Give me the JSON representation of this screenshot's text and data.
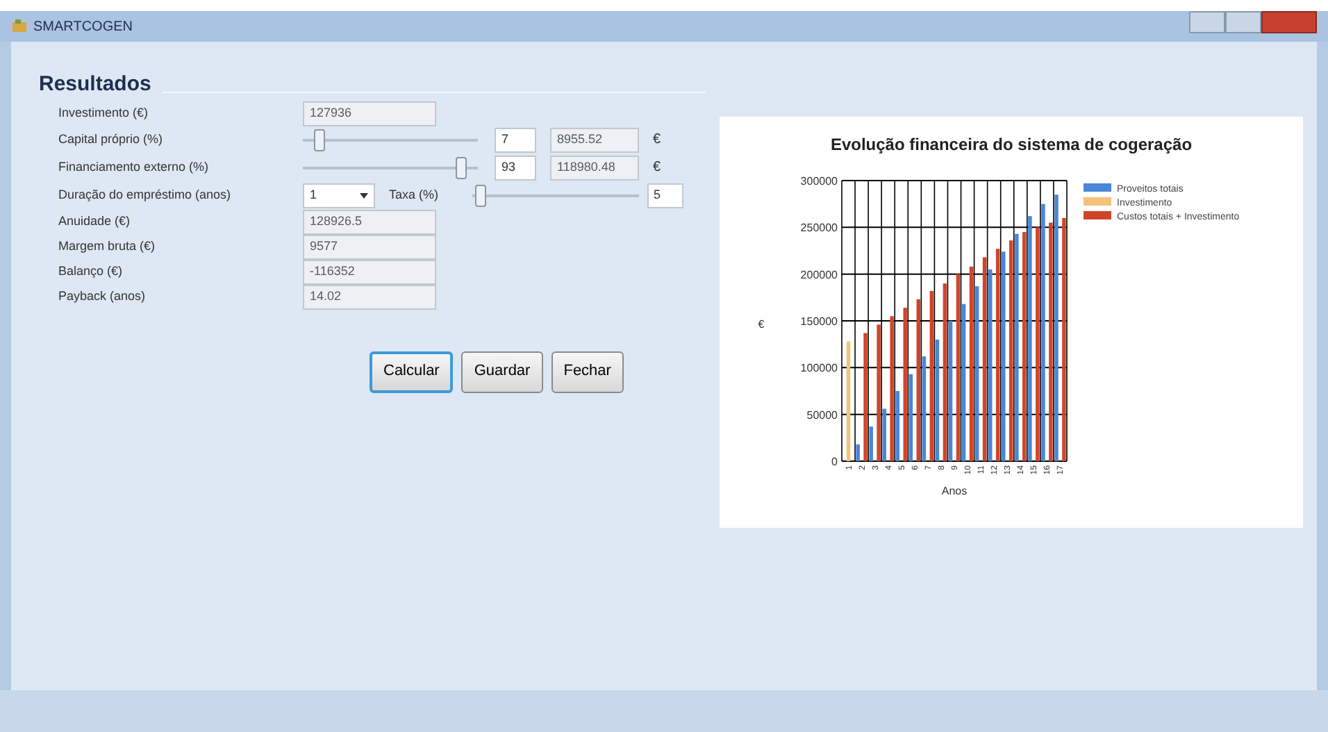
{
  "window": {
    "title": "SMARTCOGEN"
  },
  "section_title": "Resultados",
  "investimento": {
    "label": "Investimento (€)",
    "value": "127936"
  },
  "capital": {
    "label": "Capital próprio (%)",
    "level": 0.07,
    "percent": "7",
    "amount": "8955.52",
    "unit": "€"
  },
  "financiamento": {
    "label": "Financiamento externo (%)",
    "percent": "93",
    "amount": "118980.48",
    "unit": "€"
  },
  "duracao": {
    "label": "Duração do empréstimo (anos)",
    "value": "1",
    "rate_label": "Taxa (%)",
    "rate": "5"
  },
  "results": [
    {
      "label": "Anuidade (€)",
      "value": "128926.5"
    },
    {
      "label": "Margem bruta (€)",
      "value": "9577"
    },
    {
      "label": "Balanço (€)",
      "value": "-116352"
    },
    {
      "label": "Payback (anos)",
      "value": "14.02"
    }
  ],
  "buttons": [
    {
      "label": "Calcular",
      "selected": true
    },
    {
      "label": "Guardar",
      "selected": false
    },
    {
      "label": "Fechar",
      "selected": false
    }
  ],
  "chart_data": {
    "type": "bar",
    "title": "Evolução financeira do sistema de cogeração",
    "xlabel": "Anos",
    "ylabel": "€",
    "categories": [
      "1",
      "2",
      "3",
      "4",
      "5",
      "6",
      "7",
      "8",
      "9",
      "10",
      "11",
      "12",
      "13",
      "14",
      "15",
      "16",
      "17"
    ],
    "series": [
      {
        "name": "Proveitos totais",
        "color": "#4a86d8",
        "values": [
          0,
          18000,
          37000,
          56000,
          75000,
          93000,
          112000,
          130000,
          150000,
          168000,
          187000,
          205000,
          224000,
          243000,
          262000,
          275000,
          285000
        ]
      },
      {
        "name": "Investimento",
        "color": "#f5c27a",
        "values": [
          128000,
          null,
          null,
          null,
          null,
          null,
          null,
          null,
          null,
          null,
          null,
          null,
          null,
          null,
          null,
          null,
          null
        ]
      },
      {
        "name": "Custos totais + Investimento",
        "color": "#d0452a",
        "values": [
          null,
          137000,
          146000,
          155000,
          164000,
          173000,
          182000,
          190000,
          200000,
          208000,
          218000,
          227000,
          236000,
          245000,
          250000,
          255000,
          260000
        ]
      }
    ],
    "grid": true,
    "legend": true,
    "ylim": [
      0,
      300000
    ],
    "yticks": [
      0,
      50000,
      100000,
      150000,
      200000,
      250000,
      300000
    ]
  }
}
